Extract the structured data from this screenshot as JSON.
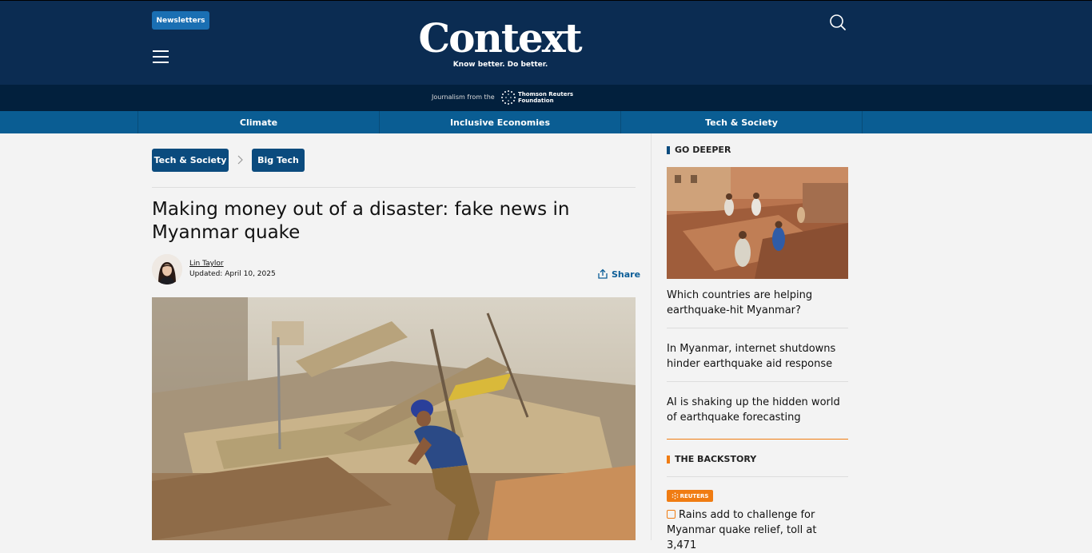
{
  "header": {
    "newsletter_label": "Newsletters",
    "logo_text": "Context",
    "tagline": "Know better. Do better.",
    "journalism_prefix": "Journalism from the",
    "foundation_line1": "Thomson Reuters",
    "foundation_line2": "Foundation",
    "icons": [
      "menu-icon",
      "search-icon"
    ]
  },
  "nav": {
    "items": [
      {
        "label": "Climate"
      },
      {
        "label": "Inclusive Economies"
      },
      {
        "label": "Tech & Society"
      }
    ]
  },
  "breadcrumb": {
    "items": [
      {
        "label": "Tech & Society"
      },
      {
        "label": "Big Tech"
      }
    ]
  },
  "article": {
    "headline": "Making money out of a disaster: fake news in Myanmar quake",
    "author": "Lin Taylor",
    "updated": "Updated: April 10, 2025",
    "share_label": "Share"
  },
  "sidebar": {
    "go_deeper_title": "GO DEEPER",
    "links": [
      {
        "title": "Which countries are helping earthquake-hit Myanmar?"
      },
      {
        "title": "In Myanmar, internet shutdowns hinder earthquake aid response"
      },
      {
        "title": "AI is shaking up the hidden world of earthquake forecasting"
      }
    ],
    "backstory_title": "THE BACKSTORY",
    "backstory_badge": "REUTERS",
    "backstory_link": "Rains add to challenge for Myanmar quake relief, toll at 3,471"
  },
  "colors": {
    "header_bg": "#0b2c52",
    "subheader_bg": "#02203d",
    "nav_bg": "#0a5d93",
    "crumb_bg": "#0b4b7e",
    "accent_orange": "#f07c12"
  }
}
